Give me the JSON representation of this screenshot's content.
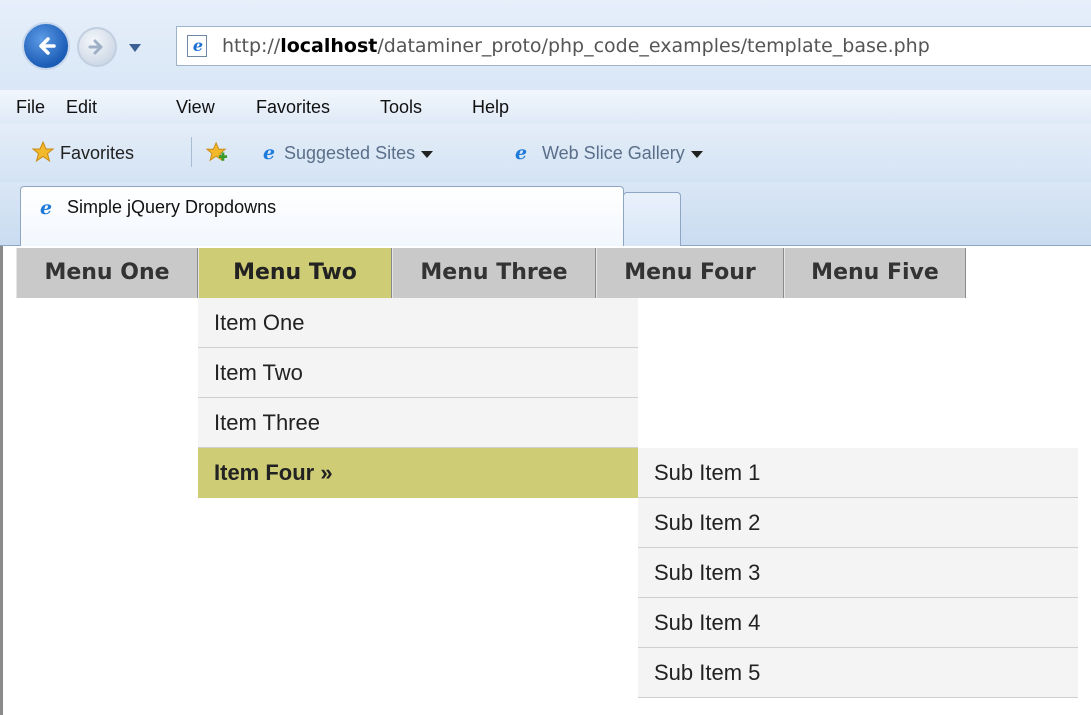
{
  "browser": {
    "url_prefix": "http://",
    "url_host": "localhost",
    "url_path": "/dataminer_proto/php_code_examples/template_base.php",
    "menu": [
      "File",
      "Edit",
      "View",
      "Favorites",
      "Tools",
      "Help"
    ],
    "favorites_label": "Favorites",
    "suggested_sites": "Suggested Sites",
    "web_slice_gallery": "Web Slice Gallery",
    "tab_title": "Simple jQuery Dropdowns"
  },
  "nav": {
    "items": [
      "Menu One",
      "Menu Two",
      "Menu Three",
      "Menu Four",
      "Menu Five"
    ],
    "active_index": 1
  },
  "dropdown": {
    "items": [
      "Item One",
      "Item Two",
      "Item Three",
      "Item Four »"
    ],
    "active_index": 3,
    "sub_items": [
      "Sub Item 1",
      "Sub Item 2",
      "Sub Item 3",
      "Sub Item 4",
      "Sub Item 5"
    ]
  },
  "colors": {
    "highlight": "#cfcc76",
    "nav_bg": "#c9c9c9",
    "dropdown_bg": "#f4f4f4"
  },
  "icons": [
    "back-icon",
    "forward-icon",
    "history-dropdown-icon",
    "ie-page-icon",
    "favorites-star-icon",
    "add-favorite-icon"
  ]
}
